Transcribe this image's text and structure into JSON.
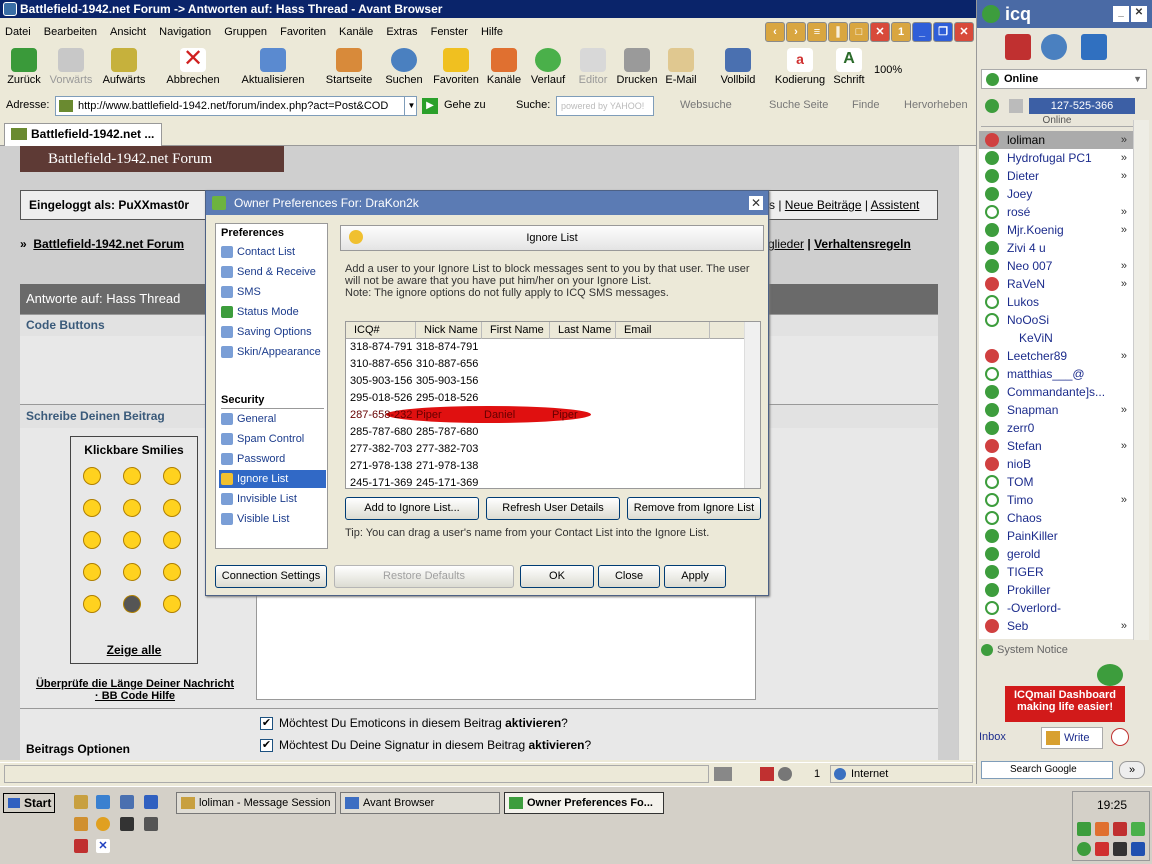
{
  "browser": {
    "title": "Battlefield-1942.net Forum -> Antworten auf: Hass Thread - Avant Browser",
    "menu": [
      "Datei",
      "Bearbeiten",
      "Ansicht",
      "Navigation",
      "Gruppen",
      "Favoriten",
      "Kanäle",
      "Extras",
      "Fenster",
      "Hilfe"
    ],
    "window_btn_1": "1",
    "toolbar": {
      "back": "Zurück",
      "forward": "Vorwärts",
      "up": "Aufwärts",
      "stop": "Abbrechen",
      "refresh": "Aktualisieren",
      "home": "Startseite",
      "search": "Suchen",
      "favorites": "Favoriten",
      "channels": "Kanäle",
      "history": "Verlauf",
      "editor": "Editor",
      "print": "Drucken",
      "email": "E-Mail",
      "fullscreen": "Vollbild",
      "encoding": "Kodierung",
      "font": "Schrift",
      "zoom": "100%"
    },
    "address_label": "Adresse:",
    "address": "http://www.battlefield-1942.net/forum/index.php?act=Post&COD",
    "goto": "Gehe zu",
    "search_label": "Suche:",
    "search_placeholder": "powered by YAHOO!",
    "websearch": "Websuche",
    "search_page": "Suche Seite",
    "find": "Finde",
    "highlight": "Hervorheben",
    "tab_title": "Battlefield-1942.net ...",
    "status_zone": "Internet",
    "status_count": "1"
  },
  "forum": {
    "banner": "Battlefield-1942.net Forum",
    "logged_in": "Eingeloggt als: PuXXmast0r",
    "top_links": [
      "s",
      "Neue Beiträge",
      "Assistent"
    ],
    "breadcrumb": "Battlefield-1942.net Forum",
    "nav_links": [
      "glieder",
      "Verhaltensregeln"
    ],
    "reply_head": "Antworte auf: Hass Thread",
    "code_buttons": "Code Buttons",
    "write_post": "Schreibe Deinen Beitrag",
    "smilies_title": "Klickbare Smilies",
    "smilies_all": "Zeige alle",
    "check_length": "Überprüfe die Länge Deiner Nachricht",
    "bb_help": "· BB Code Hilfe",
    "options_label": "Beitrags Optionen",
    "opt_emoticons_pre": "Möchtest Du Emoticons in diesem Beitrag ",
    "opt_emoticons_b": "aktivieren",
    "opt_signature_pre": "Möchtest Du Deine Signatur in diesem Beitrag ",
    "opt_signature_b": "aktivieren",
    "opt_q": "?"
  },
  "dialog": {
    "title": "Owner Preferences For: DraKon2k",
    "preferences_header": "Preferences",
    "preferences": [
      "Contact List",
      "Send & Receive",
      "SMS",
      "Status Mode",
      "Saving Options",
      "Skin/Appearance"
    ],
    "security_header": "Security",
    "security": [
      "General",
      "Spam Control",
      "Password",
      "Ignore List",
      "Invisible List",
      "Visible List"
    ],
    "selected": "Ignore List",
    "section_title": "Ignore List",
    "description": "Add a user to your Ignore List to block messages sent to you by that user.  The user will not be aware that you have put him/her on your Ignore List.",
    "note": "Note: The ignore options do not fully apply to ICQ SMS messages.",
    "columns": [
      "ICQ#",
      "Nick Name",
      "First Name",
      "Last Name",
      "Email"
    ],
    "rows": [
      {
        "icq": "318-874-791",
        "nick": "318-874-791",
        "first": "",
        "last": ""
      },
      {
        "icq": "310-887-656",
        "nick": "310-887-656",
        "first": "",
        "last": ""
      },
      {
        "icq": "305-903-156",
        "nick": "305-903-156",
        "first": "",
        "last": ""
      },
      {
        "icq": "295-018-526",
        "nick": "295-018-526",
        "first": "",
        "last": ""
      },
      {
        "icq": "287-658-232",
        "nick": "Piper",
        "first": "Daniel",
        "last": "Piper"
      },
      {
        "icq": "285-787-680",
        "nick": "285-787-680",
        "first": "",
        "last": ""
      },
      {
        "icq": "277-382-703",
        "nick": "277-382-703",
        "first": "",
        "last": ""
      },
      {
        "icq": "271-978-138",
        "nick": "271-978-138",
        "first": "",
        "last": ""
      },
      {
        "icq": "245-171-369",
        "nick": "245-171-369",
        "first": "",
        "last": ""
      }
    ],
    "btn_add": "Add to Ignore List...",
    "btn_refresh": "Refresh User Details",
    "btn_remove": "Remove from Ignore List",
    "tip": "Tip:  You can drag a user's name from your Contact List into the Ignore List.",
    "btn_connection": "Connection Settings",
    "btn_restore": "Restore Defaults",
    "btn_ok": "OK",
    "btn_close": "Close",
    "btn_apply": "Apply"
  },
  "icq": {
    "title": "icq",
    "status": "Online",
    "uin": "127-525-366",
    "online_header": "Online",
    "contacts": [
      {
        "name": "loliman",
        "s": "na",
        "arrow": true
      },
      {
        "name": "Hydrofugal PC1",
        "s": "on",
        "arrow": true
      },
      {
        "name": "Dieter",
        "s": "on",
        "arrow": true
      },
      {
        "name": "Joey",
        "s": "on",
        "arrow": false
      },
      {
        "name": "rosé",
        "s": "away",
        "arrow": true
      },
      {
        "name": "Mjr.Koenig",
        "s": "on",
        "arrow": true
      },
      {
        "name": "Zivi 4 u",
        "s": "on",
        "arrow": false
      },
      {
        "name": "Neo 007",
        "s": "on",
        "arrow": true
      },
      {
        "name": "RaVeN",
        "s": "na",
        "arrow": true
      },
      {
        "name": "Lukos",
        "s": "away",
        "arrow": false
      },
      {
        "name": "NoOoSi",
        "s": "away",
        "arrow": false
      },
      {
        "name": "KeViN",
        "s": "none",
        "arrow": false
      },
      {
        "name": "Leetcher89",
        "s": "na",
        "arrow": true
      },
      {
        "name": "matthias___@",
        "s": "away",
        "arrow": false
      },
      {
        "name": "Commandante]s...",
        "s": "on",
        "arrow": false
      },
      {
        "name": "Snapman",
        "s": "on",
        "arrow": true
      },
      {
        "name": "zerr0",
        "s": "on",
        "arrow": false
      },
      {
        "name": "Stefan",
        "s": "na",
        "arrow": true
      },
      {
        "name": "nioB",
        "s": "na",
        "arrow": false
      },
      {
        "name": "TOM",
        "s": "away",
        "arrow": false
      },
      {
        "name": "Timo",
        "s": "away",
        "arrow": true
      },
      {
        "name": "Chaos",
        "s": "away",
        "arrow": false
      },
      {
        "name": "PainKiller",
        "s": "on",
        "arrow": false
      },
      {
        "name": "gerold",
        "s": "on",
        "arrow": false
      },
      {
        "name": "TIGER",
        "s": "on",
        "arrow": false
      },
      {
        "name": "Prokiller",
        "s": "on",
        "arrow": false
      },
      {
        "name": "-Overlord-",
        "s": "away",
        "arrow": false
      },
      {
        "name": "Seb",
        "s": "na",
        "arrow": true
      }
    ],
    "system_notice": "System Notice",
    "ad": "ICQmail Dashboard making life easier!",
    "inbox": "Inbox",
    "write": "Write",
    "search_label": "Search Google"
  },
  "taskbar": {
    "start": "Start",
    "tasks": [
      "loliman - Message Session",
      "Avant Browser",
      "Owner Preferences Fo..."
    ],
    "clock": "19:25"
  }
}
